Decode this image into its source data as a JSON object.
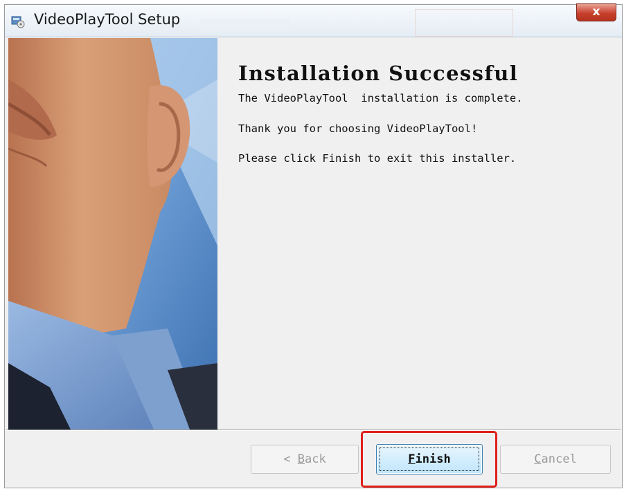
{
  "window": {
    "title": "VideoPlayTool Setup",
    "close_glyph": "x"
  },
  "icons": {
    "title_icon": "installer-icon",
    "close_icon": "close-icon"
  },
  "content": {
    "heading": "Installation Successful",
    "line1": "The VideoPlayTool  installation is complete.",
    "line2": "Thank you for choosing VideoPlayTool!",
    "line3": "Please click Finish to exit this installer."
  },
  "buttons": {
    "back": {
      "prefix": "< ",
      "mnemonic": "B",
      "rest": "ack",
      "enabled": false
    },
    "finish": {
      "mnemonic": "F",
      "rest": "inish",
      "enabled": true,
      "focused": true
    },
    "cancel": {
      "mnemonic": "C",
      "rest": "ancel",
      "enabled": false
    }
  },
  "colors": {
    "highlight": "#e0201b",
    "close_button": "#c7402c",
    "finish_border": "#3c7fb1"
  }
}
